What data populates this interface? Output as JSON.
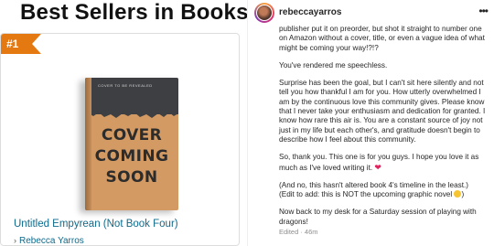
{
  "amazon": {
    "section_title": "Best Sellers in Books",
    "rank_badge": "#1",
    "book": {
      "cover_top_text": "COVER TO BE REVEALED",
      "cover_line1": "COVER",
      "cover_line2": "COMING",
      "cover_line3": "SOON",
      "title": "Untitled Empyrean (Not Book Four)",
      "author": "Rebecca Yarros"
    },
    "colors": {
      "badge": "#e47911",
      "link": "#0f6a8b"
    }
  },
  "instagram": {
    "username": "rebeccayarros",
    "more_icon": "more-horizontal-icon",
    "paragraphs": [
      "publisher put it on preorder, but shot it straight to number one on Amazon without a cover, title, or even a vague idea of what might be coming your way!?!?",
      "You've rendered me speechless.",
      "Surprise has been the goal, but I can't sit here silently and not tell you how thankful I am for you. How utterly overwhelmed I am by the continuous love this community gives. Please know that I never take your enthusiasm and dedication for granted. I know how rare this air is. You are a constant source of joy not just in my life but each other's, and gratitude doesn't begin to describe how I feel about this community.",
      "So, thank you. This one is for you guys. I hope you love it as much as I've loved writing it.",
      "(And no, this hasn't altered book 4's timeline in the least.)",
      "(Edit to add: this is NOT the upcoming graphic novel",
      "Now back to my desk for a Saturday session of playing with dragons!"
    ],
    "edited_label": "Edited · 46m",
    "heart_glyph": "❤"
  }
}
